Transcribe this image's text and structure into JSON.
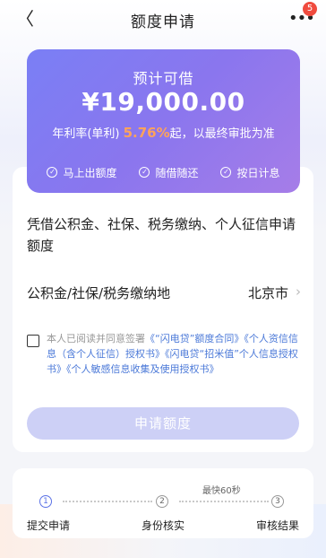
{
  "nav": {
    "back_glyph": "〈",
    "title": "额度申请",
    "more_glyph": "•••",
    "badge_count": "5"
  },
  "hero": {
    "label": "预计可借",
    "amount": "¥19,000.00",
    "rate_prefix": "年利率(单利)",
    "rate_value": "5.76%",
    "rate_suffix": "起，以最终审批为准",
    "features": [
      "马上出额度",
      "随借随还",
      "按日计息"
    ]
  },
  "form": {
    "requirement_text": "凭借公积金、社保、税务缴纳、个人征信申请额度",
    "fund_label": "公积金/社保/税务缴纳地",
    "fund_value": "北京市",
    "agree_prefix": "本人已阅读并同意签署",
    "agree_links": [
      "《“闪电贷”额度合同》",
      "《个人资信信息（含个人征信）授权书》",
      "《闪电贷“招米值”个人信息授权书》",
      "《个人敏感信息收集及使用授权书》"
    ],
    "apply_button": "申请额度"
  },
  "progress": {
    "fastest_note": "最快60秒",
    "steps": [
      {
        "num": "1",
        "label": "提交申请"
      },
      {
        "num": "2",
        "label": "身份核实"
      },
      {
        "num": "3",
        "label": "审核结果"
      }
    ]
  },
  "colors": {
    "accent": "#5b72e6",
    "rate_highlight": "#ffa35a",
    "link": "#4b79d8",
    "badge": "#f04b3e"
  }
}
